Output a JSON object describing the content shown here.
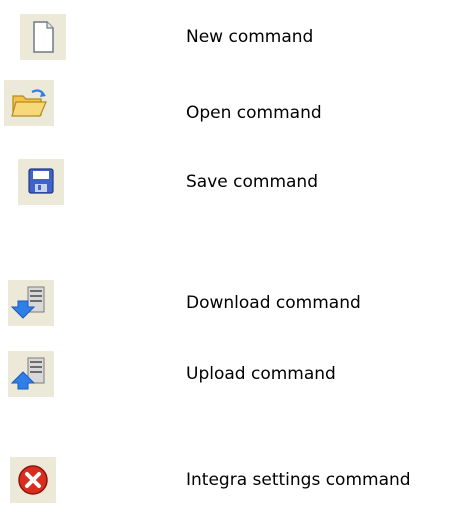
{
  "commands": [
    {
      "icon": "new-document-icon",
      "label": "New command"
    },
    {
      "icon": "open-folder-icon",
      "label": "Open command"
    },
    {
      "icon": "floppy-disk-icon",
      "label": "Save command"
    },
    {
      "icon": "download-arrow-icon",
      "label": "Download command"
    },
    {
      "icon": "upload-arrow-icon",
      "label": "Upload command"
    },
    {
      "icon": "red-x-circle-icon",
      "label": "Integra settings command"
    }
  ],
  "colors": {
    "tile_background": "#ece9d8",
    "folder_yellow": "#f2c24a",
    "floppy_blue": "#3f63c9",
    "arrow_blue": "#2f7fe8",
    "stop_red": "#d92d1e"
  }
}
